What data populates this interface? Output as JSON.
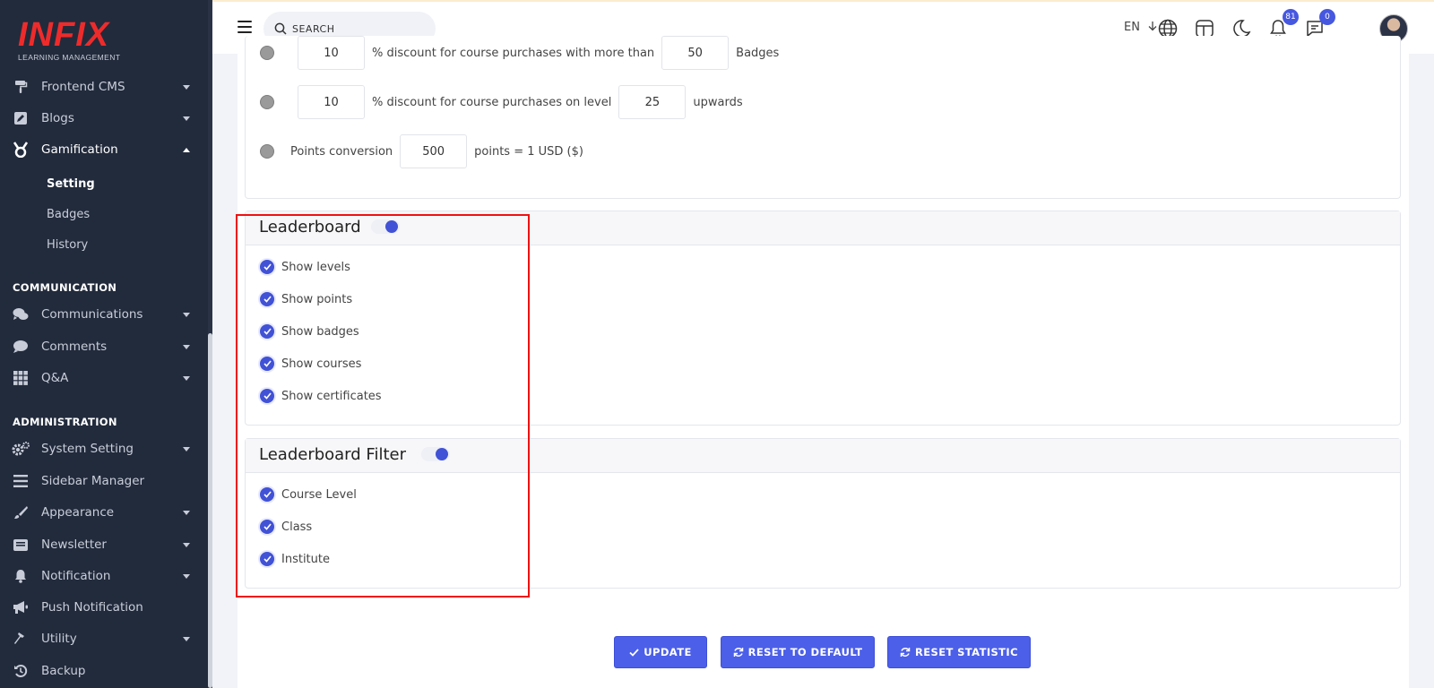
{
  "brand": {
    "logo_text": "INFIX",
    "logo_sub": "LEARNING MANAGEMENT"
  },
  "sidebar": {
    "items": [
      {
        "label": "Frontend CMS",
        "icon": "paint-roller-icon",
        "expandable": true
      },
      {
        "label": "Blogs",
        "icon": "edit-square-icon",
        "expandable": true
      },
      {
        "label": "Gamification",
        "icon": "medal-icon",
        "expandable": true,
        "expanded": true,
        "active": true
      }
    ],
    "gamification_sub": [
      {
        "label": "Setting",
        "active": true
      },
      {
        "label": "Badges"
      },
      {
        "label": "History"
      }
    ],
    "section_communication": "COMMUNICATION",
    "communication_items": [
      {
        "label": "Communications",
        "icon": "chat-bubbles-icon"
      },
      {
        "label": "Comments",
        "icon": "comment-icon"
      },
      {
        "label": "Q&A",
        "icon": "grid-icon"
      }
    ],
    "section_administration": "ADMINISTRATION",
    "admin_items": [
      {
        "label": "System Setting",
        "icon": "gears-icon"
      },
      {
        "label": "Sidebar Manager",
        "icon": "bars-icon"
      },
      {
        "label": "Appearance",
        "icon": "brush-icon"
      },
      {
        "label": "Newsletter",
        "icon": "envelope-open-icon"
      },
      {
        "label": "Notification",
        "icon": "bell-icon"
      },
      {
        "label": "Push Notification",
        "icon": "megaphone-icon"
      },
      {
        "label": "Utility",
        "icon": "hammer-icon"
      },
      {
        "label": "Backup",
        "icon": "history-icon"
      }
    ]
  },
  "header": {
    "search_placeholder": "SEARCH",
    "language": "EN",
    "notification_count": "81",
    "message_count": "0"
  },
  "discount": {
    "row1": {
      "value": "10",
      "text": "% discount for course purchases with more than",
      "value2": "50",
      "suffix": "Badges"
    },
    "row2": {
      "value": "10",
      "text": "% discount for course purchases on level",
      "value2": "25",
      "suffix": "upwards"
    },
    "row3": {
      "prefix": "Points conversion",
      "value": "500",
      "suffix": "points = 1 USD ($)"
    }
  },
  "leaderboard": {
    "title": "Leaderboard",
    "enabled": true,
    "options": [
      "Show levels",
      "Show points",
      "Show badges",
      "Show courses",
      "Show certificates"
    ]
  },
  "leaderboard_filter": {
    "title": "Leaderboard Filter",
    "enabled": true,
    "options": [
      "Course Level",
      "Class",
      "Institute"
    ]
  },
  "buttons": {
    "update": "UPDATE",
    "reset_default": "RESET TO DEFAULT",
    "reset_statistic": "RESET STATISTIC"
  },
  "colors": {
    "accent": "#4c5fe8",
    "sidebar_bg": "#222b3c",
    "logo_red": "#ee2b2b",
    "highlight": "#ee1111"
  }
}
